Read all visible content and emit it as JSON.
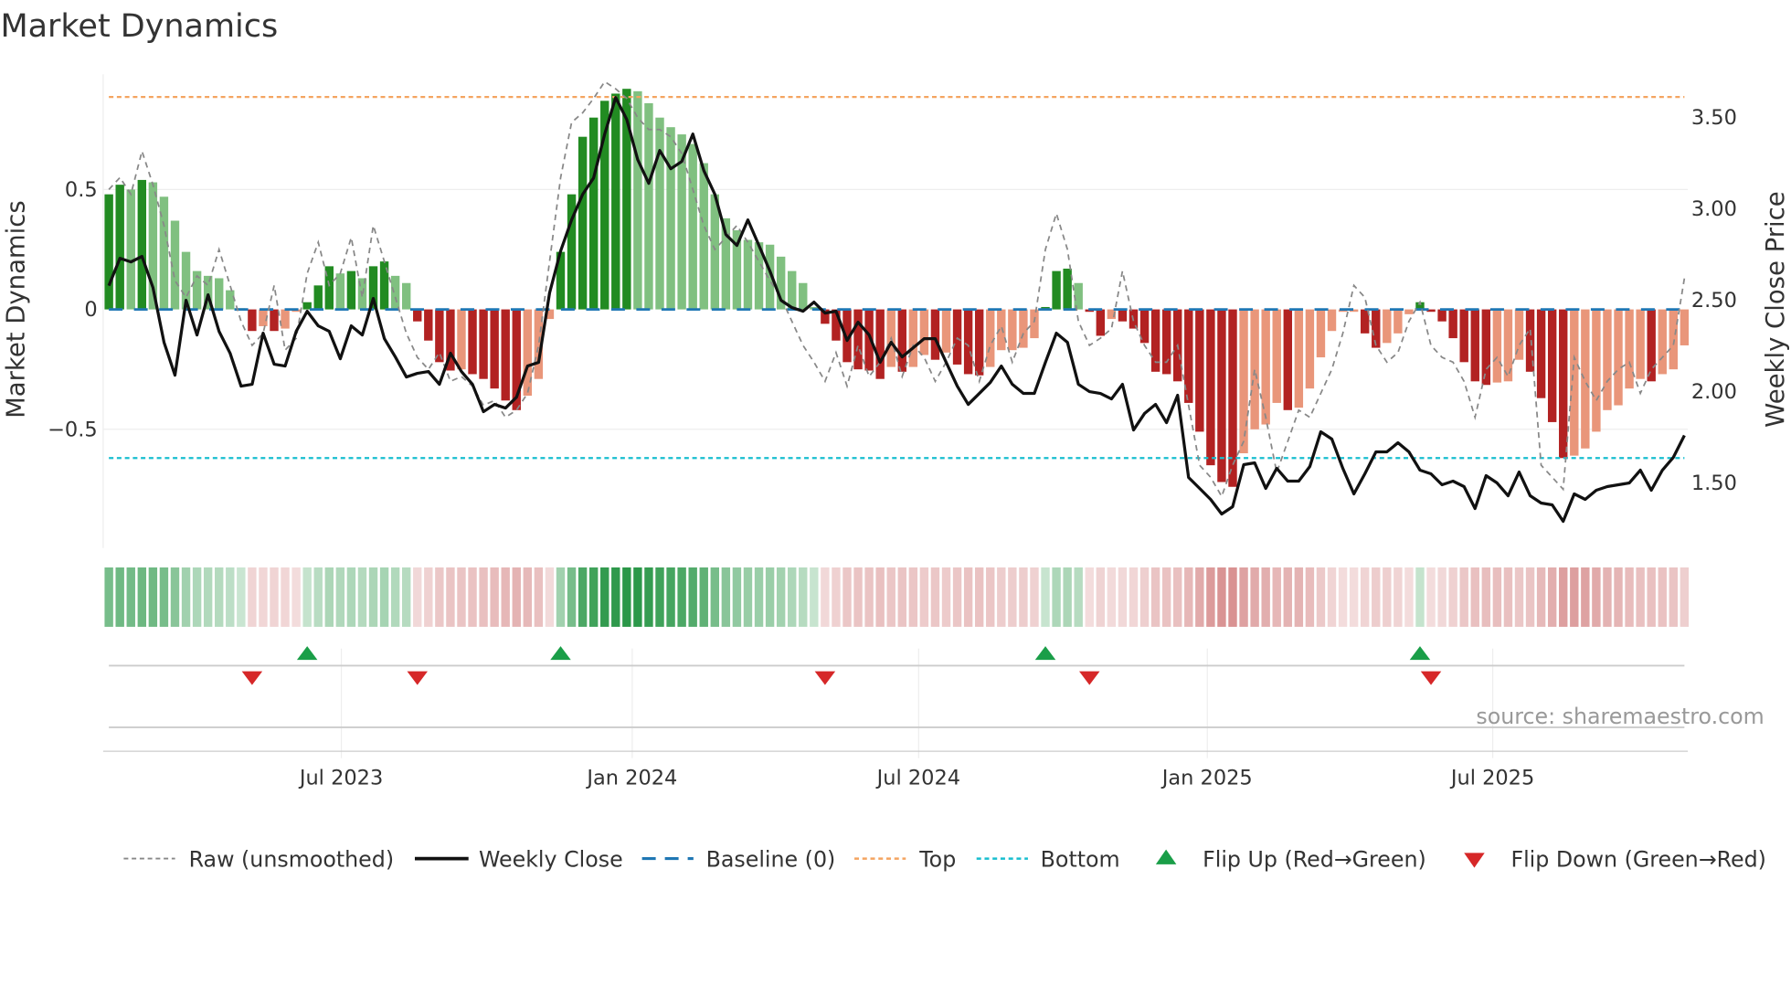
{
  "chart_data": {
    "type": "bar",
    "title": "Market Dynamics",
    "ylabel": "Market Dynamics",
    "y2label": "Weekly Close Price",
    "ylim": [
      -0.98,
      0.98
    ],
    "y2lim": [
      1.2,
      3.62
    ],
    "y_ticks": [
      {
        "value": 0.5,
        "label": "0.5"
      },
      {
        "value": 0,
        "label": "0"
      },
      {
        "value": -0.5,
        "label": "−0.5"
      }
    ],
    "y2_ticks": [
      {
        "value": 3.5,
        "label": "3.50"
      },
      {
        "value": 3.0,
        "label": "3.00"
      },
      {
        "value": 2.5,
        "label": "2.50"
      },
      {
        "value": 2.0,
        "label": "2.00"
      },
      {
        "value": 1.5,
        "label": "1.50"
      }
    ],
    "x_ticks": [
      {
        "week": 22.1,
        "label": "Jul 2023"
      },
      {
        "week": 48.5,
        "label": "Jan 2024"
      },
      {
        "week": 74.5,
        "label": "Jul 2024"
      },
      {
        "week": 100.7,
        "label": "Jan 2025"
      },
      {
        "week": 126.6,
        "label": "Jul 2025"
      }
    ],
    "top_level": 0.886,
    "bottom_level": -0.62,
    "baseline": 0,
    "momentum": [
      0.48,
      0.52,
      0.5,
      0.54,
      0.53,
      0.47,
      0.37,
      0.24,
      0.16,
      0.14,
      0.13,
      0.08,
      0.005,
      -0.09,
      -0.07,
      -0.09,
      -0.08,
      -0.01,
      0.03,
      0.1,
      0.18,
      0.15,
      0.16,
      0.13,
      0.18,
      0.2,
      0.14,
      0.11,
      -0.05,
      -0.13,
      -0.22,
      -0.255,
      -0.25,
      -0.27,
      -0.29,
      -0.33,
      -0.38,
      -0.42,
      -0.36,
      -0.29,
      -0.04,
      0.24,
      0.48,
      0.72,
      0.8,
      0.87,
      0.9,
      0.92,
      0.91,
      0.86,
      0.8,
      0.76,
      0.73,
      0.69,
      0.61,
      0.48,
      0.38,
      0.33,
      0.29,
      0.28,
      0.27,
      0.22,
      0.16,
      0.11,
      0.01,
      -0.06,
      -0.13,
      -0.22,
      -0.25,
      -0.255,
      -0.29,
      -0.24,
      -0.26,
      -0.24,
      -0.19,
      -0.21,
      -0.18,
      -0.23,
      -0.27,
      -0.275,
      -0.24,
      -0.17,
      -0.17,
      -0.16,
      -0.12,
      0.01,
      0.16,
      0.17,
      0.11,
      -0.01,
      -0.11,
      -0.04,
      -0.05,
      -0.08,
      -0.14,
      -0.26,
      -0.27,
      -0.3,
      -0.39,
      -0.51,
      -0.65,
      -0.72,
      -0.74,
      -0.6,
      -0.5,
      -0.48,
      -0.39,
      -0.42,
      -0.41,
      -0.33,
      -0.2,
      -0.09,
      -0.01,
      -0.01,
      -0.1,
      -0.16,
      -0.14,
      -0.1,
      -0.02,
      0.03,
      -0.01,
      -0.05,
      -0.12,
      -0.22,
      -0.3,
      -0.315,
      -0.305,
      -0.3,
      -0.21,
      -0.26,
      -0.37,
      -0.47,
      -0.62,
      -0.61,
      -0.58,
      -0.51,
      -0.42,
      -0.4,
      -0.33,
      -0.29,
      -0.3,
      -0.27,
      -0.25,
      -0.15
    ],
    "raw": [
      0.5,
      0.55,
      0.48,
      0.66,
      0.52,
      0.35,
      0.12,
      0.05,
      0.14,
      0.1,
      0.25,
      0.1,
      -0.05,
      -0.15,
      -0.1,
      0.1,
      -0.17,
      -0.12,
      0.15,
      0.28,
      0.1,
      0.15,
      0.3,
      0.05,
      0.35,
      0.2,
      0.05,
      -0.1,
      -0.2,
      -0.25,
      -0.18,
      -0.3,
      -0.28,
      -0.32,
      -0.4,
      -0.38,
      -0.45,
      -0.42,
      -0.35,
      -0.15,
      0.2,
      0.55,
      0.78,
      0.82,
      0.88,
      0.95,
      0.92,
      0.88,
      0.8,
      0.75,
      0.75,
      0.72,
      0.65,
      0.5,
      0.35,
      0.25,
      0.3,
      0.35,
      0.28,
      0.2,
      0.12,
      0.05,
      -0.05,
      -0.15,
      -0.22,
      -0.3,
      -0.18,
      -0.32,
      -0.15,
      -0.28,
      -0.22,
      -0.12,
      -0.28,
      -0.15,
      -0.2,
      -0.3,
      -0.22,
      -0.12,
      -0.15,
      -0.3,
      -0.15,
      -0.07,
      -0.22,
      -0.1,
      -0.05,
      0.25,
      0.4,
      0.25,
      -0.05,
      -0.15,
      -0.12,
      -0.08,
      0.16,
      -0.05,
      -0.15,
      -0.22,
      -0.22,
      -0.15,
      -0.4,
      -0.65,
      -0.7,
      -0.78,
      -0.65,
      -0.55,
      -0.25,
      -0.45,
      -0.68,
      -0.55,
      -0.42,
      -0.45,
      -0.35,
      -0.25,
      -0.1,
      0.1,
      0.05,
      -0.15,
      -0.22,
      -0.18,
      -0.05,
      0.03,
      -0.15,
      -0.2,
      -0.22,
      -0.3,
      -0.45,
      -0.25,
      -0.2,
      -0.28,
      -0.15,
      -0.08,
      -0.65,
      -0.7,
      -0.75,
      -0.2,
      -0.3,
      -0.38,
      -0.3,
      -0.25,
      -0.22,
      -0.35,
      -0.25,
      -0.2,
      -0.15,
      0.13
    ],
    "close": [
      2.58,
      2.73,
      2.71,
      2.74,
      2.57,
      2.27,
      2.09,
      2.5,
      2.31,
      2.53,
      2.33,
      2.21,
      2.03,
      2.04,
      2.32,
      2.15,
      2.14,
      2.33,
      2.44,
      2.36,
      2.33,
      2.18,
      2.36,
      2.31,
      2.51,
      2.29,
      2.19,
      2.08,
      2.1,
      2.11,
      2.04,
      2.21,
      2.11,
      2.04,
      1.89,
      1.93,
      1.91,
      1.97,
      2.14,
      2.16,
      2.54,
      2.77,
      2.94,
      3.08,
      3.17,
      3.41,
      3.61,
      3.49,
      3.27,
      3.14,
      3.32,
      3.22,
      3.26,
      3.41,
      3.21,
      3.08,
      2.86,
      2.8,
      2.94,
      2.8,
      2.66,
      2.5,
      2.46,
      2.44,
      2.49,
      2.43,
      2.44,
      2.28,
      2.38,
      2.31,
      2.16,
      2.27,
      2.19,
      2.24,
      2.29,
      2.29,
      2.16,
      2.03,
      1.93,
      1.99,
      2.05,
      2.14,
      2.04,
      1.99,
      1.99,
      2.16,
      2.32,
      2.27,
      2.04,
      2.0,
      1.99,
      1.96,
      2.04,
      1.79,
      1.88,
      1.93,
      1.83,
      1.98,
      1.53,
      1.47,
      1.41,
      1.33,
      1.37,
      1.6,
      1.61,
      1.47,
      1.58,
      1.51,
      1.51,
      1.59,
      1.78,
      1.74,
      1.58,
      1.44,
      1.55,
      1.67,
      1.67,
      1.72,
      1.67,
      1.57,
      1.55,
      1.49,
      1.51,
      1.48,
      1.36,
      1.54,
      1.5,
      1.43,
      1.56,
      1.43,
      1.39,
      1.38,
      1.29,
      1.44,
      1.41,
      1.46,
      1.48,
      1.49,
      1.5,
      1.57,
      1.46,
      1.57,
      1.64,
      1.76
    ],
    "flip_up_weeks": [
      19,
      42,
      86,
      120
    ],
    "flip_down_weeks": [
      14,
      29,
      66,
      90,
      121
    ],
    "colors": {
      "pos_strong": "#228b22",
      "pos_weak": "#80c080",
      "neg_strong": "#b22222",
      "neg_weak": "#e9967a",
      "close": "#111111",
      "raw": "#888888",
      "baseline": "#1f77b4",
      "top": "#f4a460",
      "bottom": "#17becf",
      "flip_up": "#1a9e48",
      "flip_down": "#d62728"
    },
    "legend": [
      {
        "key": "raw",
        "label": "Raw (unsmoothed)"
      },
      {
        "key": "close",
        "label": "Weekly Close"
      },
      {
        "key": "baseline",
        "label": "Baseline (0)"
      },
      {
        "key": "top",
        "label": "Top"
      },
      {
        "key": "bottom",
        "label": "Bottom"
      },
      {
        "key": "flip_up",
        "label": "Flip Up (Red→Green)"
      },
      {
        "key": "flip_down",
        "label": "Flip Down (Green→Red)"
      }
    ],
    "legend_position": "bottom",
    "source": "source: sharemaestro.com"
  }
}
